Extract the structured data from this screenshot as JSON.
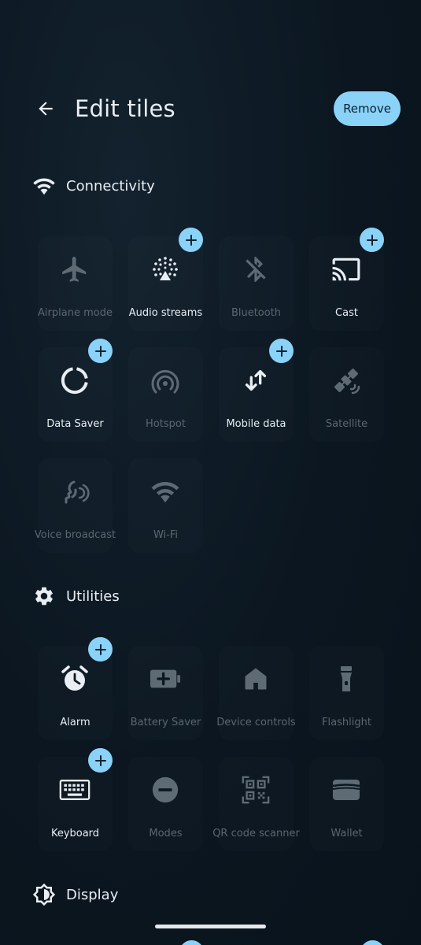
{
  "header": {
    "title": "Edit tiles",
    "remove_label": "Remove",
    "back_icon": "arrow-back-icon"
  },
  "colors": {
    "background": "#0b1721",
    "accent": "#8ad2f8",
    "active_text": "#e8eef3",
    "inactive_text": "#5b6670"
  },
  "sections": {
    "connectivity": {
      "label": "Connectivity",
      "icon": "wifi-icon",
      "tiles": [
        {
          "label": "Airplane mode",
          "icon": "airplane-icon",
          "active": false,
          "add": false
        },
        {
          "label": "Audio streams",
          "icon": "audio-streams-icon",
          "active": true,
          "add": true
        },
        {
          "label": "Bluetooth",
          "icon": "bluetooth-off-icon",
          "active": false,
          "add": false
        },
        {
          "label": "Cast",
          "icon": "cast-icon",
          "active": true,
          "add": true
        },
        {
          "label": "Data Saver",
          "icon": "data-saver-icon",
          "active": true,
          "add": true
        },
        {
          "label": "Hotspot",
          "icon": "hotspot-icon",
          "active": false,
          "add": false
        },
        {
          "label": "Mobile data",
          "icon": "mobile-data-icon",
          "active": true,
          "add": true
        },
        {
          "label": "Satellite",
          "icon": "satellite-icon",
          "active": false,
          "add": false
        },
        {
          "label": "Voice broadcast",
          "icon": "voice-broadcast-icon",
          "active": false,
          "add": false
        },
        {
          "label": "Wi-Fi",
          "icon": "wifi-tile-icon",
          "active": false,
          "add": false
        }
      ]
    },
    "utilities": {
      "label": "Utilities",
      "icon": "gear-icon",
      "tiles": [
        {
          "label": "Alarm",
          "icon": "alarm-icon",
          "active": true,
          "add": true
        },
        {
          "label": "Battery Saver",
          "icon": "battery-saver-icon",
          "active": false,
          "add": false
        },
        {
          "label": "Device controls",
          "icon": "home-icon",
          "active": false,
          "add": false
        },
        {
          "label": "Flashlight",
          "icon": "flashlight-icon",
          "active": false,
          "add": false
        },
        {
          "label": "Keyboard",
          "icon": "keyboard-icon",
          "active": true,
          "add": true
        },
        {
          "label": "Modes",
          "icon": "modes-icon",
          "active": false,
          "add": false
        },
        {
          "label": "QR code scanner",
          "icon": "qr-code-icon",
          "active": false,
          "add": false
        },
        {
          "label": "Wallet",
          "icon": "wallet-icon",
          "active": false,
          "add": false
        }
      ]
    },
    "display": {
      "label": "Display",
      "icon": "brightness-icon"
    }
  }
}
